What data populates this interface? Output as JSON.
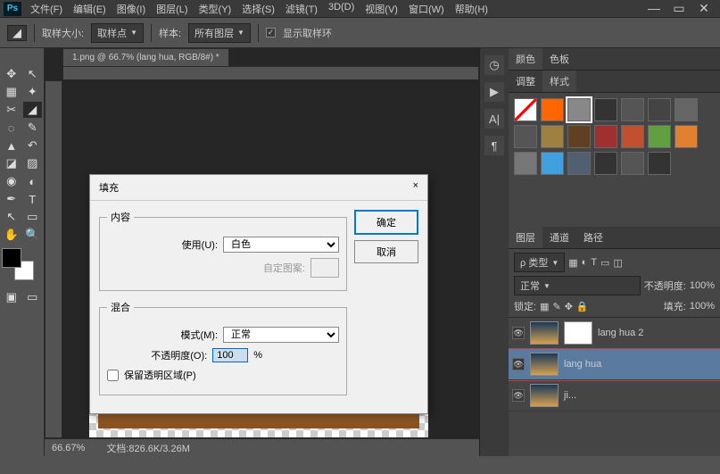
{
  "app": {
    "logo": "Ps"
  },
  "menu": [
    "文件(F)",
    "编辑(E)",
    "图像(I)",
    "图层(L)",
    "类型(Y)",
    "选择(S)",
    "滤镜(T)",
    "3D(D)",
    "视图(V)",
    "窗口(W)",
    "帮助(H)"
  ],
  "options": {
    "sample_size_label": "取样大小:",
    "sample_size_value": "取样点",
    "sample_label": "样本:",
    "sample_value": "所有图层",
    "show_ring": "显示取样环",
    "show_ring_checked": "✓"
  },
  "document": {
    "tab": "1.png @ 66.7% (lang hua, RGB/8#) *"
  },
  "status": {
    "zoom": "66.67%",
    "docinfo": "文档:826.6K/3.26M"
  },
  "panel_color": {
    "tabs": [
      "颜色",
      "色板"
    ],
    "subtabs": [
      "调整",
      "样式"
    ]
  },
  "style_colors": [
    "#fff",
    "#f60",
    "#888",
    "#333",
    "#555",
    "#444",
    "#666",
    "#555",
    "#a08040",
    "#604020",
    "#a03030",
    "#c05030",
    "#60a040",
    "#e08030",
    "#777",
    "#40a0e0",
    "#506070",
    "#333",
    "#555",
    "#333"
  ],
  "layers_panel": {
    "tabs": [
      "图层",
      "通道",
      "路径"
    ],
    "kind_label": "ρ 类型",
    "blend_value": "正常",
    "opacity_label": "不透明度:",
    "opacity_value": "100%",
    "lock_label": "锁定:",
    "fill_label": "填充:",
    "fill_value": "100%",
    "layers": [
      {
        "name": "lang hua 2",
        "hasMask": true
      },
      {
        "name": "lang hua",
        "active": true
      },
      {
        "name": "ji..."
      }
    ]
  },
  "dialog": {
    "title": "填充",
    "close": "×",
    "content_legend": "内容",
    "use_label": "使用(U):",
    "use_value": "白色",
    "custom_pattern": "自定图案:",
    "blend_legend": "混合",
    "mode_label": "模式(M):",
    "mode_value": "正常",
    "opacity_label": "不透明度(O):",
    "opacity_value": "100",
    "percent": "%",
    "preserve_label": "保留透明区域(P)",
    "ok": "确定",
    "cancel": "取消"
  }
}
